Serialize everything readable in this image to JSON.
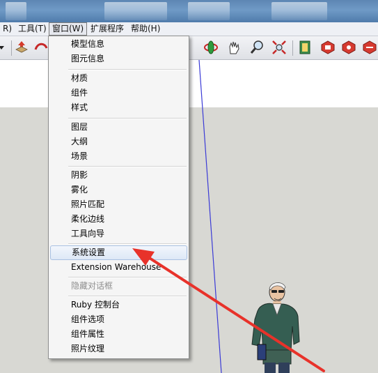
{
  "menubar": {
    "items": [
      {
        "label": "R)"
      },
      {
        "label": "工具(T)"
      },
      {
        "label": "窗口(W)"
      },
      {
        "label": "扩展程序"
      },
      {
        "label": "帮助(H)"
      }
    ]
  },
  "toolbar": {
    "icons": [
      "dropdown-arrow-icon",
      "push-pull-icon",
      "follow-me-icon",
      "orbit-icon",
      "pan-icon",
      "zoom-icon",
      "zoom-extents-icon",
      "section-plane-icon",
      "3d-warehouse-icon",
      "extension-icon",
      "model-share-icon"
    ]
  },
  "window_menu": {
    "items": [
      {
        "label": "模型信息",
        "enabled": true
      },
      {
        "label": "图元信息",
        "enabled": true
      },
      {
        "label": "材质",
        "enabled": true
      },
      {
        "label": "组件",
        "enabled": true
      },
      {
        "label": "样式",
        "enabled": true
      },
      {
        "label": "图层",
        "enabled": true
      },
      {
        "label": "大纲",
        "enabled": true
      },
      {
        "label": "场景",
        "enabled": true
      },
      {
        "label": "阴影",
        "enabled": true
      },
      {
        "label": "雾化",
        "enabled": true
      },
      {
        "label": "照片匹配",
        "enabled": true
      },
      {
        "label": "柔化边线",
        "enabled": true
      },
      {
        "label": "工具向导",
        "enabled": true
      },
      {
        "label": "系统设置",
        "enabled": true,
        "highlighted": true
      },
      {
        "label": "Extension Warehouse",
        "enabled": true
      },
      {
        "label": "隐藏对话框",
        "enabled": false
      },
      {
        "label": "Ruby 控制台",
        "enabled": true
      },
      {
        "label": "组件选项",
        "enabled": true
      },
      {
        "label": "组件属性",
        "enabled": true
      },
      {
        "label": "照片纹理",
        "enabled": true
      }
    ]
  },
  "colors": {
    "annotation_arrow": "#e8322a",
    "blue_axis": "#3a3ad6",
    "ground": "#d8d8d3",
    "menu_highlight": "#dde8f6"
  }
}
